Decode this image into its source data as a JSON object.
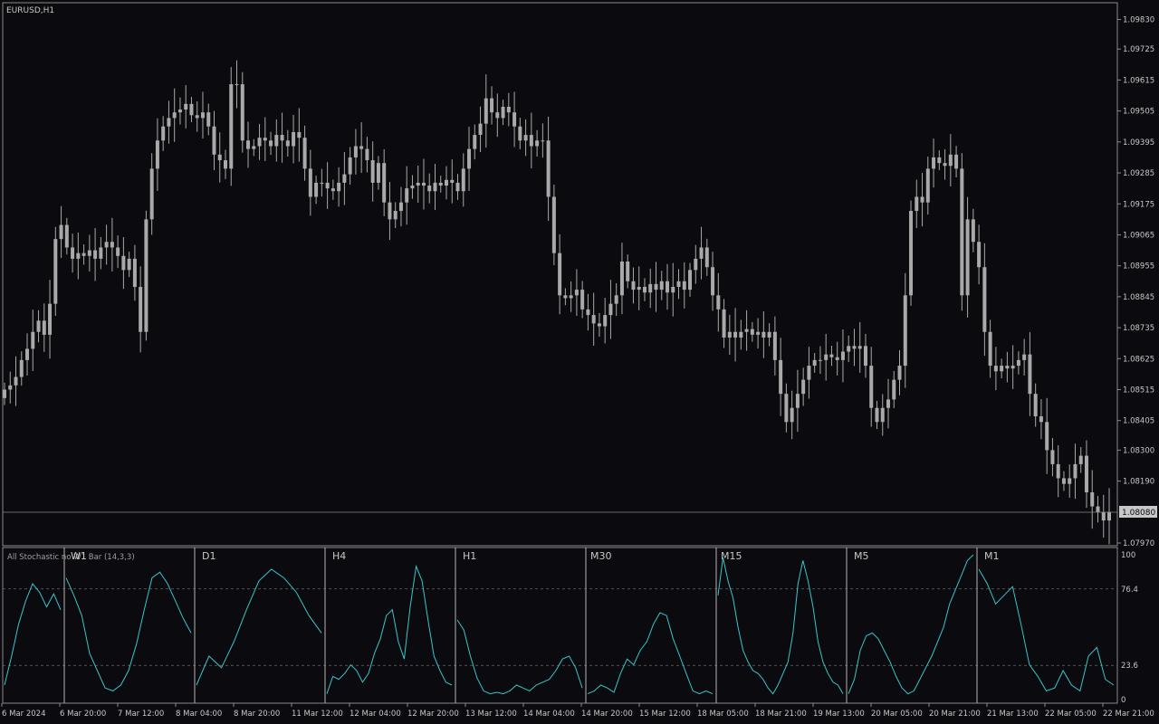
{
  "chart": {
    "title": "EURUSD,H1",
    "current_price": "1.08080",
    "price_axis": [
      "1.09830",
      "1.09725",
      "1.09615",
      "1.09505",
      "1.09395",
      "1.09285",
      "1.09175",
      "1.09065",
      "1.08955",
      "1.08845",
      "1.08735",
      "1.08625",
      "1.08515",
      "1.08405",
      "1.08300",
      "1.08190",
      "1.07970"
    ],
    "time_axis": [
      "6 Mar 2024",
      "6 Mar 20:00",
      "7 Mar 12:00",
      "8 Mar 04:00",
      "8 Mar 20:00",
      "11 Mar 12:00",
      "12 Mar 04:00",
      "12 Mar 20:00",
      "13 Mar 12:00",
      "14 Mar 04:00",
      "14 Mar 20:00",
      "15 Mar 12:00",
      "18 Mar 05:00",
      "18 Mar 21:00",
      "19 Mar 13:00",
      "20 Mar 05:00",
      "20 Mar 21:00",
      "21 Mar 13:00",
      "22 Mar 05:00",
      "22 Mar 21:00"
    ]
  },
  "indicator": {
    "label": "All Stochastic no W1 Bar (14,3,3)",
    "levels": [
      "100",
      "76.4",
      "23.6",
      "0"
    ],
    "level_values": [
      100,
      76.4,
      23.6,
      0
    ],
    "panels": [
      "W1",
      "D1",
      "H4",
      "H1",
      "M30",
      "M15",
      "M5",
      "M1"
    ]
  },
  "colors": {
    "background": "#0b0b0f",
    "candle": "#a9a9a9",
    "stochastic_line": "#38c5c9",
    "grid_text": "#c8c8c8"
  },
  "chart_data": {
    "type": "line",
    "title": "",
    "price_ylim": [
      1.0797,
      1.0988
    ],
    "stoch_ylim": [
      0,
      100
    ],
    "candle_closes": [
      1.08515,
      1.0853,
      1.0856,
      1.0862,
      1.0866,
      1.0872,
      1.0876,
      1.0871,
      1.0882,
      1.0905,
      1.091,
      1.0902,
      1.0898,
      1.09,
      1.0899,
      1.0901,
      1.0898,
      1.0902,
      1.0904,
      1.0902,
      1.0899,
      1.0894,
      1.0898,
      1.0888,
      1.0872,
      1.0912,
      1.093,
      1.094,
      1.0945,
      1.0948,
      1.095,
      1.0951,
      1.0953,
      1.0949,
      1.0948,
      1.095,
      1.0945,
      1.0935,
      1.0933,
      1.093,
      1.096,
      1.096,
      1.094,
      1.0937,
      1.0938,
      1.0941,
      1.094,
      1.0938,
      1.0942,
      1.094,
      1.0938,
      1.0943,
      1.0941,
      1.093,
      1.092,
      1.0925,
      1.0925,
      1.0923,
      1.0922,
      1.0925,
      1.0928,
      1.0934,
      1.0938,
      1.0937,
      1.0933,
      1.0925,
      1.0932,
      1.0918,
      1.0912,
      1.0915,
      1.0918,
      1.0923,
      1.0924,
      1.0925,
      1.0924,
      1.0922,
      1.0925,
      1.0924,
      1.0926,
      1.0925,
      1.0922,
      1.093,
      1.0937,
      1.0942,
      1.0946,
      1.0955,
      1.095,
      1.0948,
      1.0952,
      1.095,
      1.0945,
      1.094,
      1.0942,
      1.0938,
      1.094,
      1.094,
      1.092,
      1.09,
      1.0885,
      1.0884,
      1.0885,
      1.0887,
      1.088,
      1.0878,
      1.0875,
      1.0874,
      1.0878,
      1.0882,
      1.0885,
      1.0897,
      1.089,
      1.0887,
      1.0888,
      1.0886,
      1.0889,
      1.0887,
      1.089,
      1.0886,
      1.0888,
      1.089,
      1.0887,
      1.0894,
      1.0898,
      1.0902,
      1.0895,
      1.0885,
      1.088,
      1.087,
      1.0872,
      1.087,
      1.0872,
      1.0873,
      1.0871,
      1.0872,
      1.087,
      1.0872,
      1.0862,
      1.085,
      1.084,
      1.0845,
      1.085,
      1.0855,
      1.086,
      1.0862,
      1.0862,
      1.0864,
      1.0863,
      1.0862,
      1.0865,
      1.0867,
      1.0866,
      1.0867,
      1.086,
      1.0845,
      1.084,
      1.0845,
      1.0848,
      1.0855,
      1.086,
      1.0885,
      1.0915,
      1.092,
      1.0918,
      1.093,
      1.0934,
      1.0932,
      1.0931,
      1.0935,
      1.093,
      1.0885,
      1.0912,
      1.0904,
      1.0895,
      1.0872,
      1.086,
      1.0858,
      1.086,
      1.0859,
      1.086,
      1.0862,
      1.0864,
      1.085,
      1.0842,
      1.084,
      1.083,
      1.0825,
      1.082,
      1.0818,
      1.082,
      1.0825,
      1.0828,
      1.0815,
      1.081,
      1.0808,
      1.0805,
      1.0808
    ],
    "series": [
      {
        "name": "W1",
        "values": [
          10,
          30,
          52,
          68,
          80,
          74,
          64,
          73,
          62
        ]
      },
      {
        "name": "D1",
        "values": [
          84,
          72,
          58,
          32,
          20,
          8,
          6,
          10,
          20,
          38,
          62,
          84,
          88,
          80,
          68,
          56,
          46
        ]
      },
      {
        "name": "D1",
        "values": [
          10,
          30,
          22,
          40,
          62,
          82,
          90,
          84,
          74,
          58,
          46
        ]
      },
      {
        "name": "H4",
        "values": [
          4,
          16,
          14,
          18,
          24,
          20,
          12,
          18,
          32,
          42,
          58,
          62,
          40,
          28,
          64,
          92,
          82,
          55,
          30,
          20,
          12,
          10
        ]
      },
      {
        "name": "H1",
        "values": [
          55,
          48,
          30,
          15,
          6,
          4,
          5,
          4,
          6,
          10,
          8,
          6,
          10,
          12,
          14,
          20,
          28,
          30,
          22,
          8
        ]
      },
      {
        "name": "M30",
        "values": [
          4,
          6,
          10,
          8,
          5,
          18,
          28,
          24,
          34,
          40,
          52,
          60,
          58,
          42,
          30,
          18,
          6,
          4,
          6,
          4
        ]
      },
      {
        "name": "M15",
        "values": [
          72,
          98,
          82,
          70,
          50,
          34,
          26,
          20,
          18,
          14,
          8,
          4,
          10,
          18,
          26,
          46,
          80,
          96,
          82,
          64,
          40,
          26,
          18,
          12,
          10,
          4
        ]
      },
      {
        "name": "M5",
        "values": [
          4,
          14,
          34,
          44,
          46,
          42,
          34,
          26,
          16,
          8,
          4,
          6,
          14,
          22,
          30,
          40,
          50,
          66,
          76,
          86,
          96,
          100
        ]
      },
      {
        "name": "M1",
        "values": [
          90,
          80,
          66,
          72,
          78,
          52,
          24,
          16,
          6,
          8,
          20,
          10,
          6,
          30,
          36,
          14,
          10
        ]
      }
    ]
  }
}
